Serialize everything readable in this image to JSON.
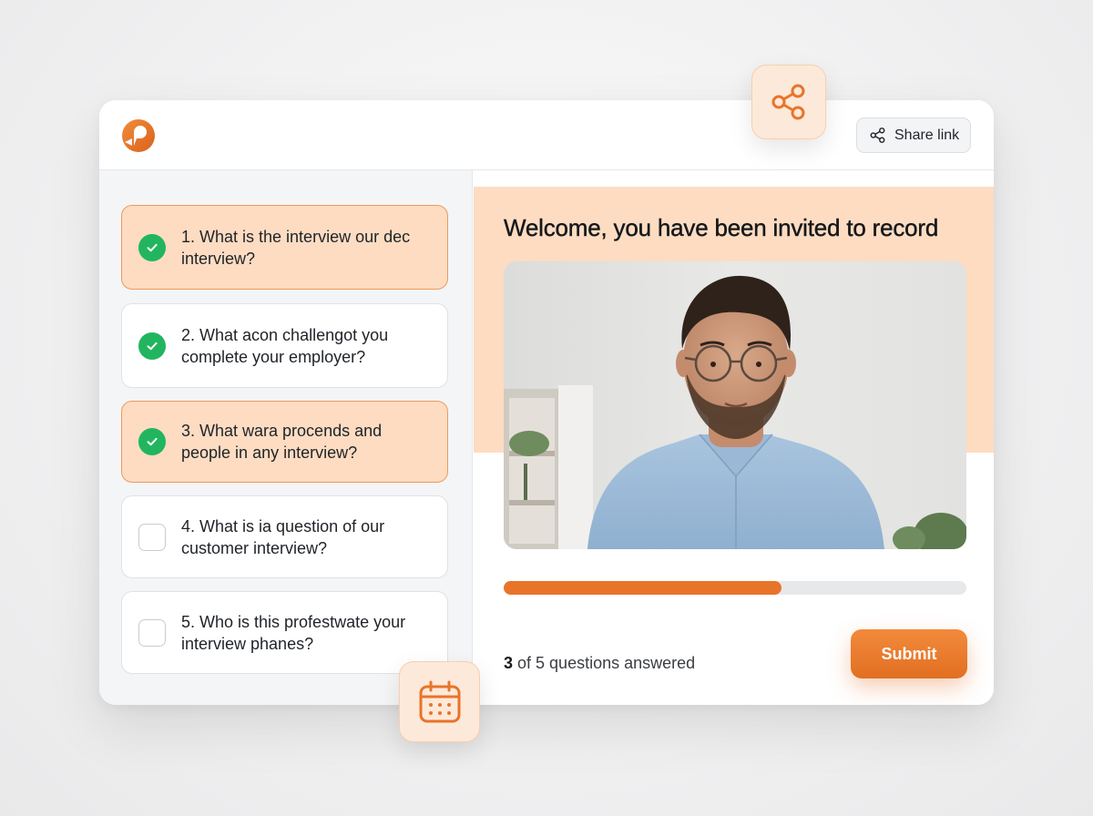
{
  "header": {
    "logo_icon": "brand-logo-icon",
    "share_button_label": "Share link",
    "share_icon": "share-icon"
  },
  "questions": [
    {
      "text": "1. What is the interview our dec interview?",
      "answered": true,
      "highlighted": true
    },
    {
      "text": "2. What acon challengot you complete your employer?",
      "answered": true,
      "highlighted": false
    },
    {
      "text": "3. What wara procends and people in any interview?",
      "answered": true,
      "highlighted": true
    },
    {
      "text": "4. What is ia question of our customer interview?",
      "answered": false,
      "highlighted": false
    },
    {
      "text": "5. Who is this profestwate your interview phanes?",
      "answered": false,
      "highlighted": false
    }
  ],
  "main": {
    "welcome_title": "Welcome, you have been invited to record",
    "video_subject": "candidate video preview",
    "progress_fraction": 0.6,
    "answered_count": "3",
    "answered_suffix": " of 5 questions answered",
    "submit_label": "Submit"
  },
  "floating": {
    "share_tile_icon": "share-icon",
    "calendar_tile_icon": "calendar-icon"
  },
  "colors": {
    "accent": "#e8742a",
    "highlight": "#fddcc2",
    "success": "#22b55f"
  }
}
